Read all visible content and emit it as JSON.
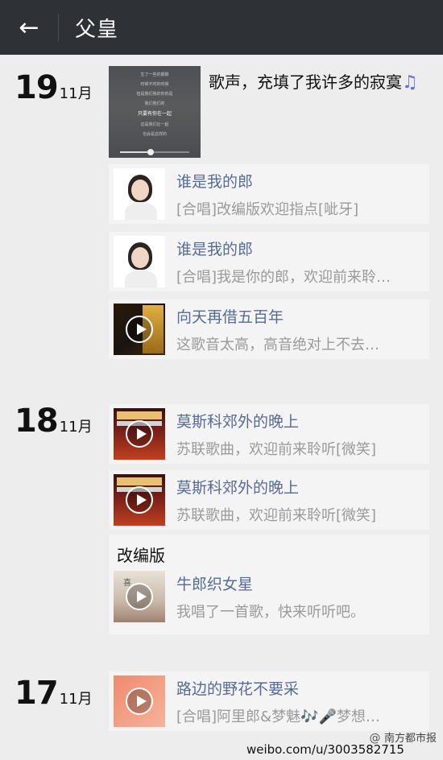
{
  "header": {
    "title": "父皇",
    "back_icon": "arrow-left-icon"
  },
  "days": [
    {
      "day": "19",
      "month": "11月"
    },
    {
      "day": "18",
      "month": "11月"
    },
    {
      "day": "17",
      "month": "11月"
    }
  ],
  "photo_post": {
    "text": "歌声，充填了我许多的寂寞",
    "note_icon": "♫",
    "lyrics": [
      "生了一些的期期",
      "时候不时的时候",
      "但是我们我的你的是",
      "我们我们的",
      "只要有你在一起",
      "这是我们在一起",
      "也会是这样的"
    ]
  },
  "shares": [
    {
      "title": "谁是我的郎",
      "desc": "[合唱]改编版欢迎指点[呲牙]",
      "thumb": "portrait"
    },
    {
      "title": "谁是我的郎",
      "desc": "[合唱]我是你的郎，欢迎前来聆…",
      "thumb": "portrait"
    },
    {
      "title": "向天再借五百年",
      "desc": "这歌音太高，高音绝对上不去…",
      "thumb": "video-dark"
    },
    {
      "title": "莫斯科郊外的晚上",
      "desc": "苏联歌曲，欢迎前来聆听[微笑]",
      "thumb": "video-red"
    },
    {
      "title": "莫斯科郊外的晚上",
      "desc": "苏联歌曲，欢迎前来聆听[微笑]",
      "thumb": "video-red"
    },
    {
      "title": "牛郎织女星",
      "desc": "我唱了一首歌，快来听听吧。",
      "thumb": "video-paper"
    },
    {
      "title": "路边的野花不要采",
      "desc": "[合唱]阿里郎&梦魅🎶🎤梦想…",
      "thumb": "video-salmon"
    }
  ],
  "repost": {
    "text": "改编版"
  },
  "watermark": {
    "name": "南方都市报",
    "url": "weibo.com/u/3003582715"
  }
}
